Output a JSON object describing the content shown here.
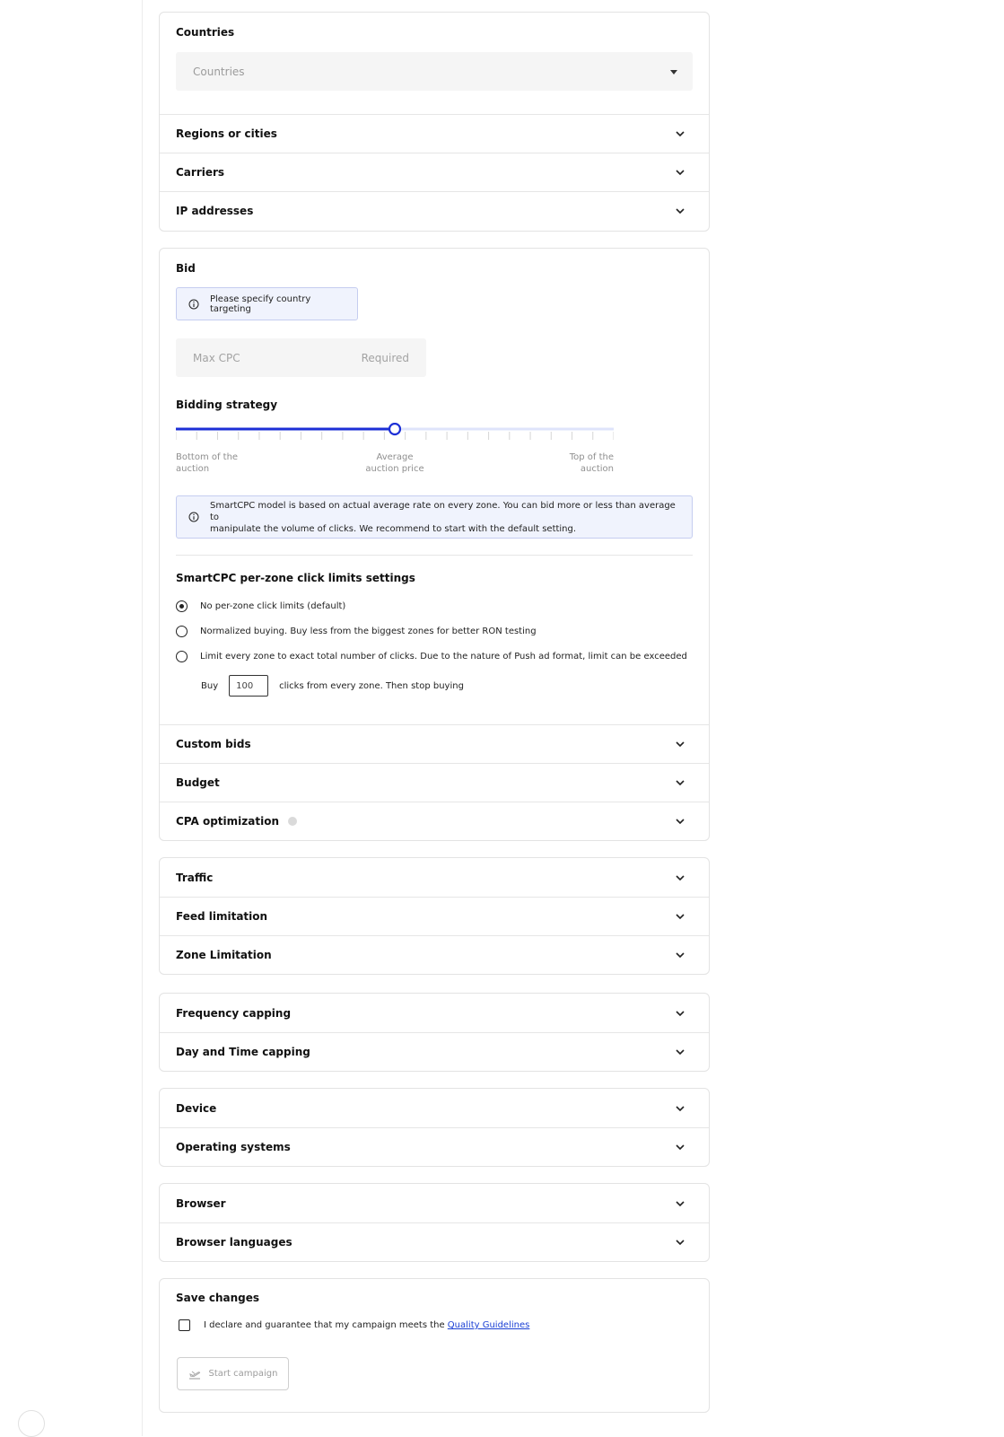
{
  "geo": {
    "countries_title": "Countries",
    "countries_placeholder": "Countries",
    "regions": "Regions or cities",
    "carriers": "Carriers",
    "ip": "IP addresses"
  },
  "bid": {
    "title": "Bid",
    "notice": "Please specify country targeting",
    "max_cpc_placeholder": "Max CPC",
    "max_cpc_required": "Required",
    "strategy_title": "Bidding strategy",
    "slider_value_fraction": 0.5,
    "slider_labels": {
      "left": [
        "Bottom of the",
        "auction"
      ],
      "center": [
        "Average",
        "auction price"
      ],
      "right": [
        "Top of the",
        "auction"
      ]
    },
    "smartcpc_info": [
      "SmartCPC model is based on actual average rate on every zone. You can bid more or less than average to",
      "manipulate the volume of clicks. We recommend to start with the default setting."
    ],
    "limits_title": "SmartCPC per-zone click limits settings",
    "options": [
      "No per-zone click limits (default)",
      "Normalized buying. Buy less from the biggest zones for better RON testing",
      "Limit every zone to exact total number of clicks. Due to the nature of Push ad format, limit can be exceeded"
    ],
    "selected_option": 0,
    "buy_prefix": "Buy",
    "buy_value": "100",
    "buy_suffix": "clicks from every zone. Then stop buying",
    "custom_bids": "Custom bids",
    "budget": "Budget",
    "cpa": "CPA optimization"
  },
  "traffic": {
    "traffic": "Traffic",
    "feed": "Feed limitation",
    "zone": "Zone Limitation"
  },
  "capping": {
    "frequency": "Frequency capping",
    "daytime": "Day and Time capping"
  },
  "device": {
    "device": "Device",
    "os": "Operating systems"
  },
  "browser": {
    "browser": "Browser",
    "languages": "Browser languages"
  },
  "save": {
    "title": "Save changes",
    "declare_text": "I declare and guarantee that my campaign meets the ",
    "guidelines_link": "Quality Guidelines",
    "start_label": "Start campaign"
  },
  "colors": {
    "accent": "#1c2fd6",
    "slider_track": "#dfe4fb"
  }
}
